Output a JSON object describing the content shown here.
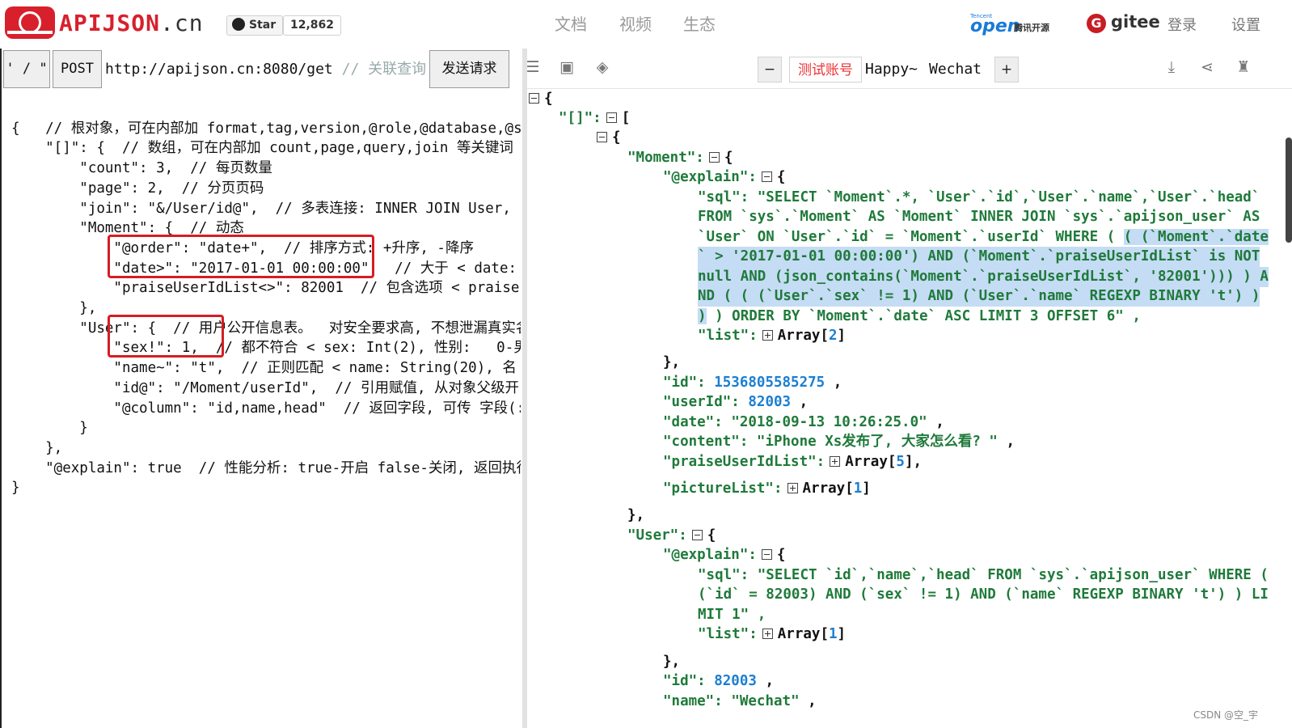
{
  "header": {
    "brand_name": "APIJSON",
    "brand_domain": ".cn",
    "star_label": "Star",
    "star_count": "12,862",
    "nav": [
      "文档",
      "视频",
      "生态"
    ],
    "tencent_small": "Tencent",
    "tencent_brand": "open",
    "tencent_cn": "腾讯开源",
    "gitee_letter": "G",
    "gitee_label": "gitee",
    "login": "登录",
    "settings": "设置"
  },
  "request": {
    "quote_btn": "' / \"",
    "method": "POST",
    "url": "http://apijson.cn:8080/get",
    "url_comment": "// 关联查询",
    "send_btn": "发送请求"
  },
  "left_code": [
    "{   // 根对象，可在内部加 format,tag,version,@role,@database,@s",
    "    \"[]\": {  // 数组，可在内部加 count,page,query,join 等关键词",
    "        \"count\": 3,  // 每页数量",
    "        \"page\": 2,  // 分页页码",
    "        \"join\": \"&/User/id@\",  // 多表连接: INNER JOIN User, F",
    "        \"Moment\": {  // 动态",
    "            \"@order\": \"date+\",  // 排序方式: +升序, -降序",
    "            \"date>\": \"2017-01-01 00:00:00\",  // 大于 < date:",
    "            \"praiseUserIdList<>\": 82001  // 包含选项 < praise",
    "        },",
    "        \"User\": {  // 用户公开信息表。  对安全要求高, 不想泄漏真实名",
    "            \"sex!\": 1,  // 都不符合 < sex: Int(2), 性别:   0-男",
    "            \"name~\": \"t\",  // 正则匹配 < name: String(20), 名",
    "            \"id@\": \"/Moment/userId\",  // 引用赋值, 从对象父级开",
    "            \"@column\": \"id,name,head\"  // 返回字段, 可传 字段(:",
    "        }",
    "    },",
    "    \"@explain\": true  // 性能分析: true-开启 false-关闭, 返回执行",
    "}"
  ],
  "toolbar": {
    "minus": "−",
    "test_account": "测试账号",
    "account1": "Happy~",
    "account2": "Wechat",
    "plus": "+"
  },
  "response": {
    "l0": "{",
    "l1_key": "\"[]\":",
    "l1_val": "[",
    "l2": "{",
    "l3_key": "\"Moment\":",
    "l3_val": "{",
    "l4_key": "\"@explain\":",
    "l4_val": "{",
    "sql1_key": "\"sql\":",
    "sql1_a": "\"SELECT `Moment`.*, `User`.`id`,`User`.`name`,`User`.`head`",
    "sql1_b": "FROM `sys`.`Moment` AS `Moment` INNER JOIN `sys`.`apijson_user` AS",
    "sql1_c_plain": "`User` ON `User`.`id` = `Moment`.`userId` WHERE ( ",
    "sql1_c_sel": "( (`Moment`.`date",
    "sql1_d": "` > '2017-01-01 00:00:00') AND (`Moment`.`praiseUserIdList` is NOT",
    "sql1_e": "null AND (json_contains(`Moment`.`praiseUserIdList`, '82001'))) ) A",
    "sql1_f": "ND ( ( (`User`.`sex` != 1) AND (`User`.`name` REGEXP BINARY 't') )",
    "sql1_g_sel": ")",
    "sql1_g_plain": " ) ORDER BY `Moment`.`date` ASC LIMIT 3 OFFSET 6\" ,",
    "list1_key": "\"list\":",
    "list1_val": "Array[",
    "list1_num": "2",
    "list1_end": "]",
    "close1": "},",
    "id_key": "\"id\":",
    "id_val": "1536805585275",
    "userId_key": "\"userId\":",
    "userId_val": "82003",
    "date_key": "\"date\":",
    "date_val": "\"2018-09-13 10:26:25.0\"",
    "content_key": "\"content\":",
    "content_val": "\"iPhone Xs发布了, 大家怎么看? \"",
    "pul_key": "\"praiseUserIdList\":",
    "pul_val": "Array[",
    "pul_num": "5",
    "pul_end": "],",
    "pic_key": "\"pictureList\":",
    "pic_val": "Array[",
    "pic_num": "1",
    "pic_end": "]",
    "close2": "},",
    "user_key": "\"User\":",
    "user_val": "{",
    "uexp_key": "\"@explain\":",
    "uexp_val": "{",
    "sql2_key": "\"sql\":",
    "sql2_a": "\"SELECT `id`,`name`,`head` FROM `sys`.`apijson_user` WHERE (",
    "sql2_b": "(`id` = 82003) AND (`sex` != 1) AND (`name` REGEXP BINARY 't') ) LI",
    "sql2_c": "MIT 1\" ,",
    "list2_key": "\"list\":",
    "list2_val": "Array[",
    "list2_num": "1",
    "list2_end": "]",
    "close3": "},",
    "uid_key": "\"id\":",
    "uid_val": "82003",
    "uname_key": "\"name\":",
    "uname_val": "\"Wechat\"",
    "comma": ","
  },
  "watermark": "CSDN @空_宇"
}
